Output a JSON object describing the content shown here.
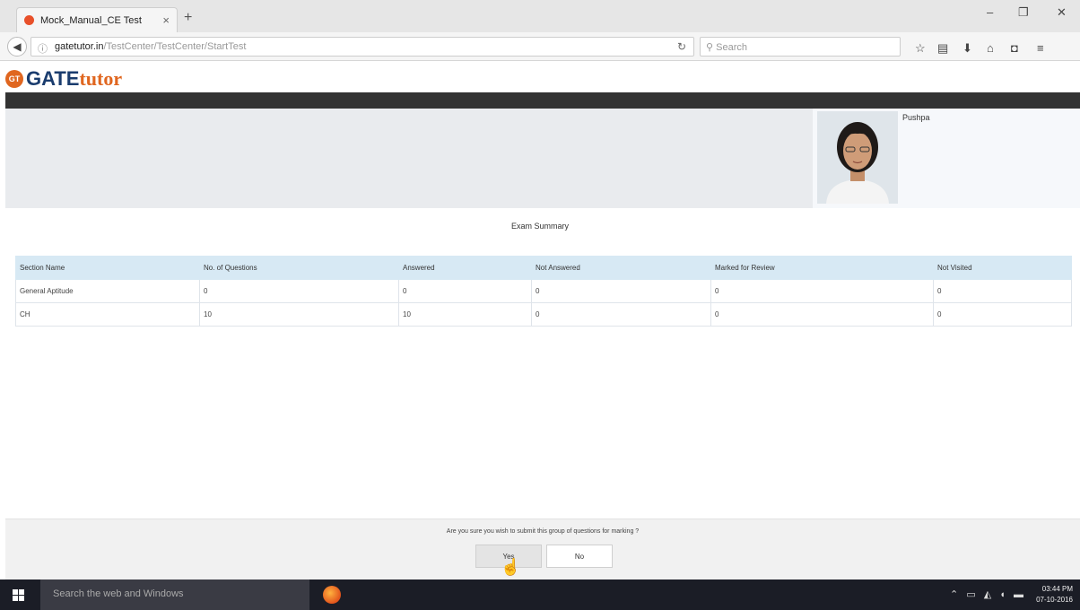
{
  "browser": {
    "tab_title": "Mock_Manual_CE Test",
    "tab_close": "×",
    "new_tab": "+",
    "url_host": "gatetutor.in",
    "url_path": "/TestCenter/TestCenter/StartTest",
    "search_placeholder": "Search",
    "window_controls": [
      "–",
      "❐",
      "✕"
    ]
  },
  "site": {
    "logo_gt": "GT",
    "logo_gate": "GATE",
    "logo_tutor": "tutor",
    "user_name": "Pushpa"
  },
  "summary": {
    "title": "Exam Summary",
    "columns": [
      "Section Name",
      "No. of Questions",
      "Answered",
      "Not Answered",
      "Marked for Review",
      "Not Visited"
    ],
    "rows": [
      [
        "General Aptitude",
        "0",
        "0",
        "0",
        "0",
        "0"
      ],
      [
        "CH",
        "10",
        "10",
        "0",
        "0",
        "0"
      ]
    ]
  },
  "confirm": {
    "question": "Are you sure you wish to submit this group of questions for marking ?",
    "yes_label": "Yes",
    "no_label": "No"
  },
  "taskbar": {
    "search_placeholder": "Search the web and Windows",
    "time": "03:44 PM",
    "date": "07-10-2016"
  }
}
